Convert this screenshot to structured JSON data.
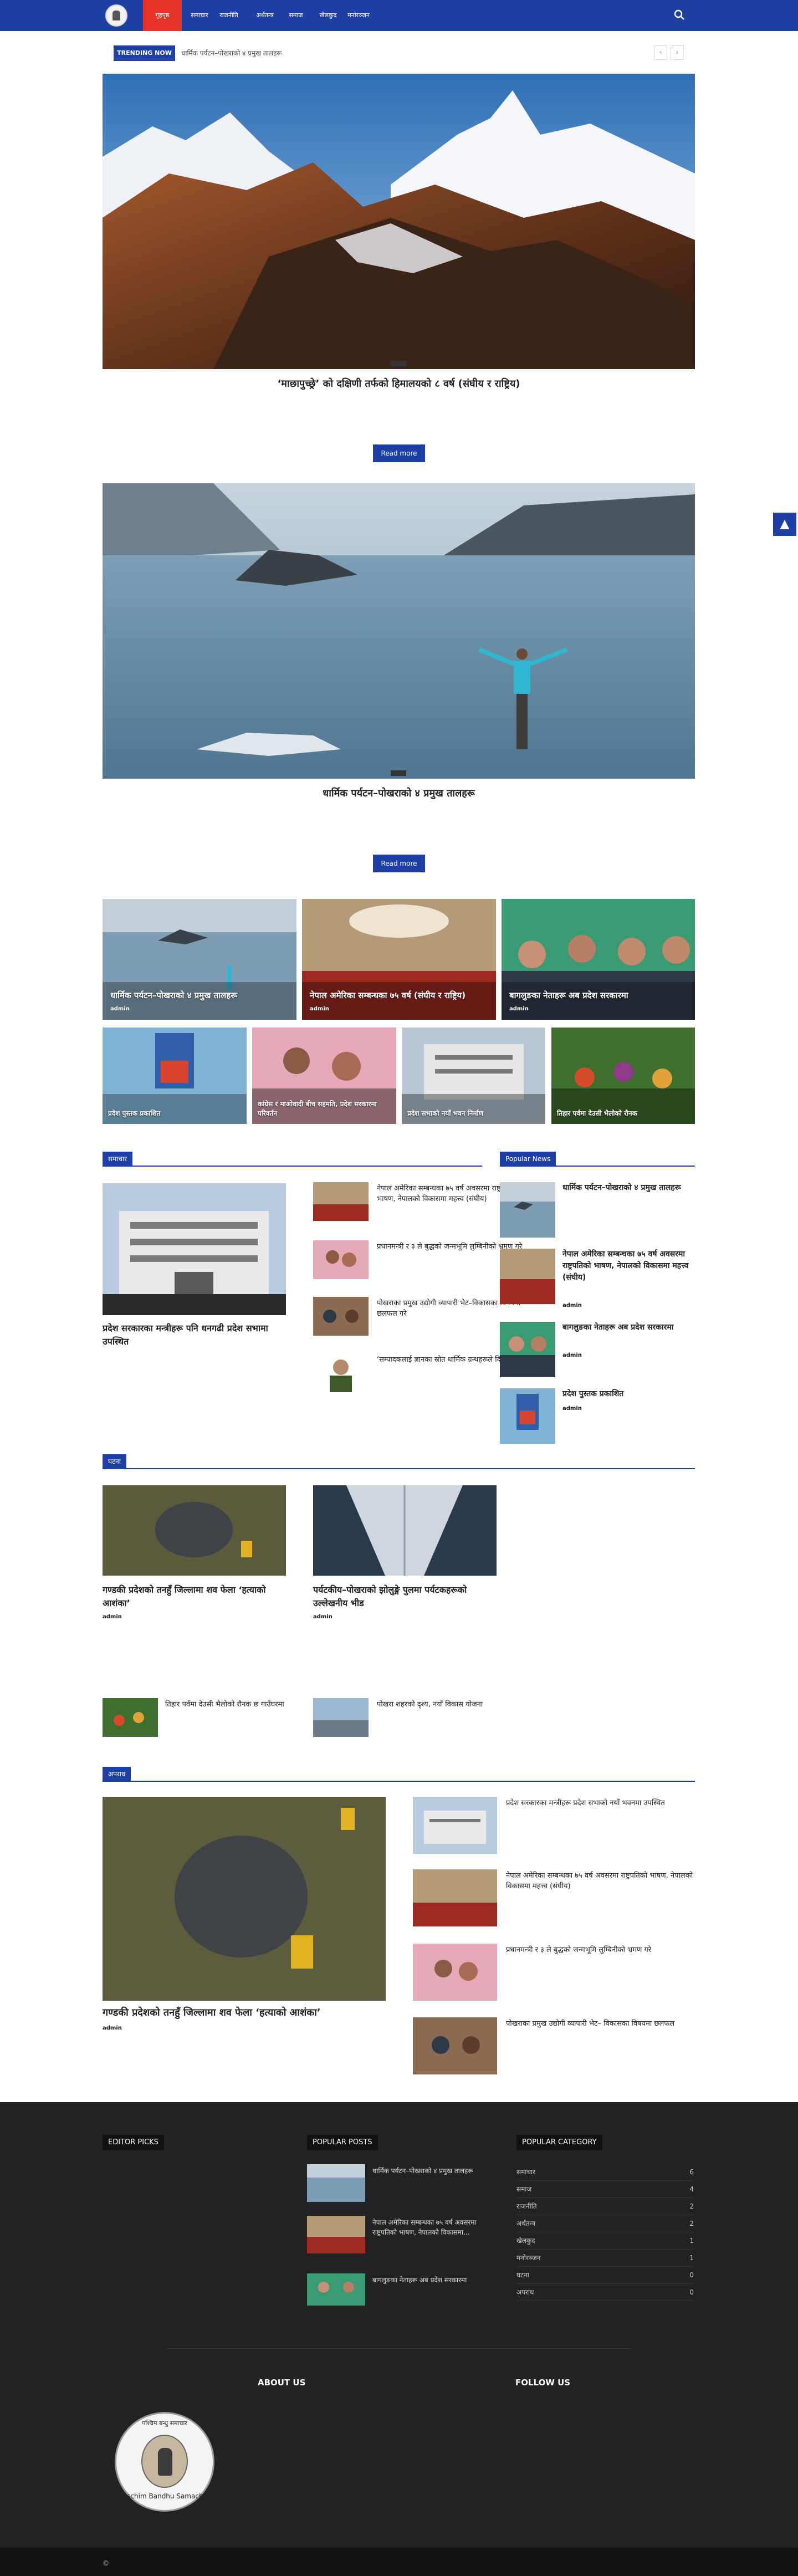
{
  "nav": {
    "items": [
      "गृहपृष्ठ",
      "समाचार",
      "राजनीति",
      "अर्थतन्त्र",
      "समाज",
      "खेलकुद",
      "मनोरञ्जन"
    ]
  },
  "trending": {
    "label": "TRENDING NOW",
    "headline": "धार्मिक पर्यटन–पोखराको ४ प्रमुख तालहरू",
    "prev": "‹",
    "next": "›"
  },
  "hero": [
    {
      "title": "‘माछापुच्छ्रे’ को दक्षिणी तर्फको हिमालयको ८ वर्ष (संघीय र राष्ट्रिय)",
      "read_more": "Read more"
    },
    {
      "title": "धार्मिक पर्यटन–पोखराको ४ प्रमुख तालहरू",
      "read_more": "Read more"
    }
  ],
  "scroll_top": "▲",
  "tiles": [
    {
      "caption": "धार्मिक पर्यटन–पोखराको ४ प्रमुख तालहरू",
      "author": "admin"
    },
    {
      "caption": "नेपाल अमेरिका सम्बन्धका ७५ वर्ष (संघीय र राष्ट्रिय)",
      "author": "admin"
    },
    {
      "caption": "बागलुङका नेताहरू अब प्रदेश सरकारमा",
      "author": "admin"
    }
  ],
  "small_tiles": [
    {
      "caption": "प्रदेश पुस्तक प्रकाशित"
    },
    {
      "caption": "कांग्रेस र माओवादी बीच सहमति, प्रदेश सरकारमा परिवर्तन"
    },
    {
      "caption": "प्रदेश सभाको नयाँ भवन निर्माण"
    },
    {
      "caption": "तिहार पर्वमा देउसी भैलोको रौनक"
    }
  ],
  "section1": {
    "tag": "समाचार",
    "lead_title": "प्रदेश सरकारका मन्त्रीहरू पनि धनगढी प्रदेश सभामा उपस्थित",
    "list": [
      "नेपाल अमेरिका सम्बन्धका ७५ वर्ष अवसरमा राष्ट्रपतिको भाषण, नेपालको विकासमा महत्त्व (संघीय)",
      "प्रधानमन्त्री र ३ ले बुद्धको जन्मभूमि लुम्बिनीको भ्रमण गरे",
      "पोखराका प्रमुख उद्योगी व्यापारी भेट–विकासका विषयमा छलफल गरे",
      "‘सम्पादकलाई ज्ञानका स्रोत धार्मिक ग्रन्थहरूले दिन्छन् बाटो’"
    ]
  },
  "popular": {
    "tag": "Popular News",
    "items": [
      {
        "title": "धार्मिक पर्यटन–पोखराको ४ प्रमुख तालहरू",
        "author": ""
      },
      {
        "title": "नेपाल अमेरिका सम्बन्धका ७५ वर्ष अवसरमा राष्ट्रपतिको भाषण, नेपालको विकासमा महत्त्व (संघीय)",
        "author": "admin"
      },
      {
        "title": "बागलुङका नेताहरू अब प्रदेश सरकारमा",
        "author": "admin"
      },
      {
        "title": "प्रदेश पुस्तक प्रकाशित",
        "author": "admin"
      }
    ]
  },
  "section2": {
    "tag": "घटना",
    "cards": [
      {
        "title": "गण्डकी प्रदेशको तनहुँ जिल्लामा शव फेला ‘हत्याको आशंका’",
        "author": "admin"
      },
      {
        "title": "पर्यटकीय–पोखराको झोलुङ्गे पुलमा पर्यटकहरूको उल्लेखनीय भीड",
        "author": "admin"
      }
    ],
    "small": [
      "तिहार पर्वमा देउसी भैलोको रौनक छ गाउँघरमा",
      "पोखरा शहरको दृश्य, नयाँ विकास योजना"
    ]
  },
  "section3": {
    "tag": "अपराध",
    "lead_title": "गण्डकी प्रदेशको तनहुँ जिल्लामा शव फेला ‘हत्याको आशंका’",
    "lead_author": "admin",
    "list": [
      "प्रदेश सरकारका मन्त्रीहरू प्रदेश सभाको नयाँ भवनमा उपस्थित",
      "नेपाल अमेरिका सम्बन्धका ७५ वर्ष अवसरमा राष्ट्रपतिको भाषण, नेपालको विकासमा महत्त्व (संघीय)",
      "प्रधानमन्त्री र ३ ले बुद्धको जन्मभूमि लुम्बिनीको भ्रमण गरे",
      "पोखराका प्रमुख उद्योगी व्यापारी भेट– विकासका विषयमा छलफल"
    ]
  },
  "footer": {
    "editor_picks": "EDITOR PICKS",
    "popular_posts": "POPULAR POSTS",
    "popular_category": "POPULAR CATEGORY",
    "posts": [
      "धार्मिक पर्यटन–पोखराको ४ प्रमुख तालहरू",
      "नेपाल अमेरिका सम्बन्धका ७५ वर्ष अवसरमा राष्ट्रपतिको भाषण, नेपालको विकासमा...",
      "बागलुङका नेताहरू अब प्रदेश सरकारमा"
    ],
    "categories": [
      {
        "name": "समाचार",
        "count": "6"
      },
      {
        "name": "समाज",
        "count": "4"
      },
      {
        "name": "राजनीति",
        "count": "2"
      },
      {
        "name": "अर्थतन्त्र",
        "count": "2"
      },
      {
        "name": "खेलकुद",
        "count": "1"
      },
      {
        "name": "मनोरञ्जन",
        "count": "1"
      },
      {
        "name": "घटना",
        "count": "0"
      },
      {
        "name": "अपराध",
        "count": "0"
      }
    ],
    "about": "ABOUT US",
    "follow": "FOLLOW US",
    "logo_text_top": "पश्चिम बन्धु समाचार",
    "logo_text_bottom": "Paschim Bandhu Samachar",
    "copyright": "©"
  },
  "colors": {
    "brand": "#1e40a5",
    "active": "#e5332a",
    "footer": "#222222"
  }
}
